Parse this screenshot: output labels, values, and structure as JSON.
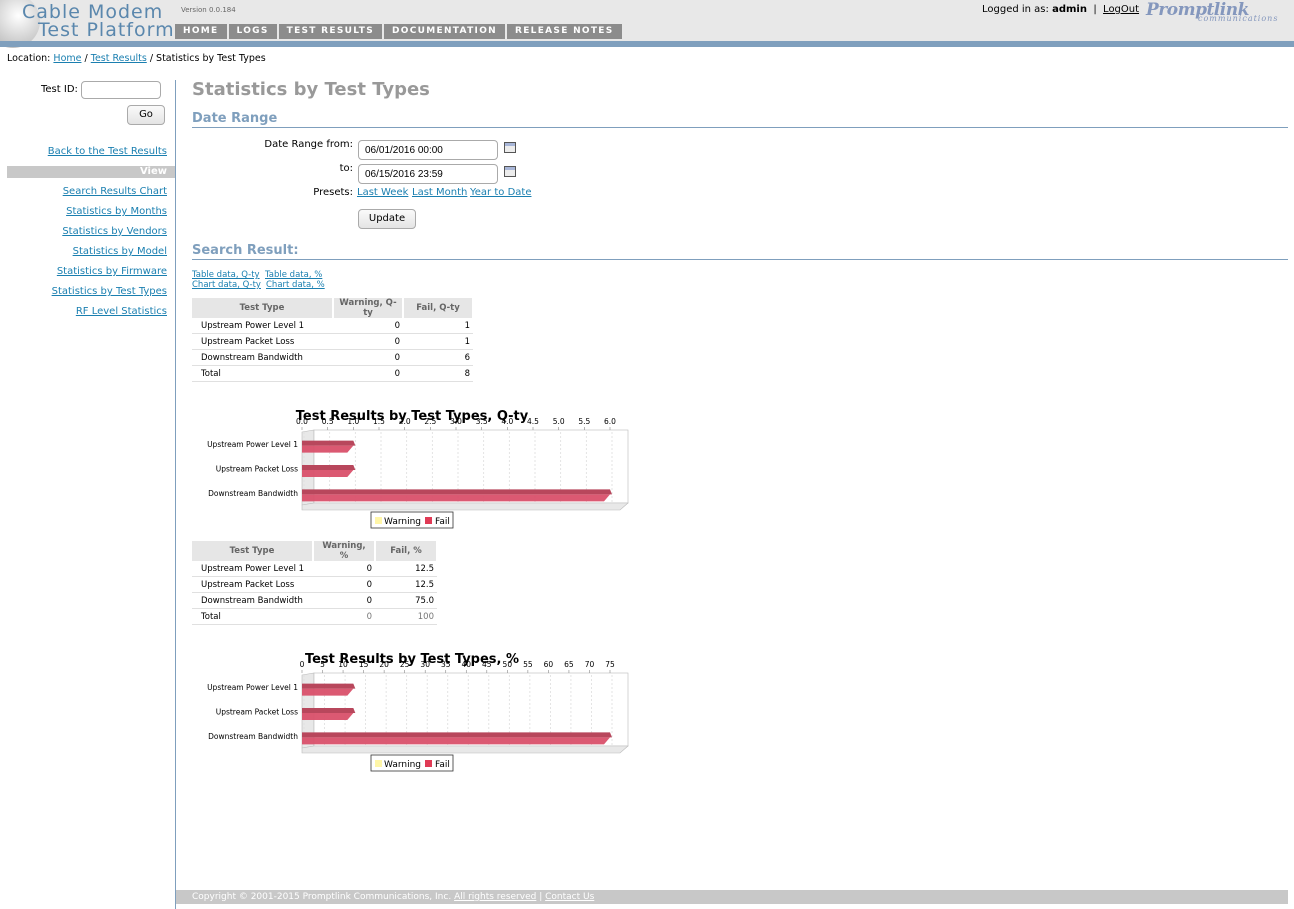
{
  "header": {
    "logo_line1": "Cable Modem",
    "logo_line2": "Test Platform",
    "version": "Version 0.0.184",
    "nav": [
      "HOME",
      "LOGS",
      "TEST RESULTS",
      "DOCUMENTATION",
      "RELEASE NOTES"
    ],
    "logged_in_label": "Logged in as:",
    "username": "admin",
    "separator": "|",
    "logout": "LogOut",
    "brand_name": "Promptlink",
    "brand_sub": "communications"
  },
  "breadcrumb": {
    "prefix": "Location:",
    "home": "Home",
    "sep": "/",
    "test_results": "Test Results",
    "current": "Statistics by Test Types"
  },
  "sidebar": {
    "test_id_label": "Test ID:",
    "test_id_value": "",
    "go": "Go",
    "back": "Back to the Test Results",
    "view_header": "View",
    "links": [
      "Search Results Chart",
      "Statistics by Months",
      "Statistics by Vendors",
      "Statistics by Model",
      "Statistics by Firmware",
      "Statistics by Test Types",
      "RF Level Statistics"
    ]
  },
  "main": {
    "title": "Statistics by Test Types",
    "date_range_title": "Date Range",
    "from_label": "Date Range from:",
    "from_value": "06/01/2016 00:00",
    "to_label": "to:",
    "to_value": "06/15/2016 23:59",
    "presets_label": "Presets:",
    "presets": [
      "Last Week",
      "Last Month",
      "Year to Date"
    ],
    "update": "Update",
    "search_result_title": "Search Result:",
    "quick_links": [
      "Table data, Q-ty",
      "Table data, %",
      "Chart data, Q-ty",
      "Chart data, %"
    ]
  },
  "qty_table": {
    "headers": [
      "Test Type",
      "Warning, Q-ty",
      "Fail, Q-ty"
    ],
    "rows": [
      [
        "Upstream Power Level 1",
        "0",
        "1"
      ],
      [
        "Upstream Packet Loss",
        "0",
        "1"
      ],
      [
        "Downstream Bandwidth",
        "0",
        "6"
      ],
      [
        "Total",
        "0",
        "8"
      ]
    ]
  },
  "pct_table": {
    "headers": [
      "Test Type",
      "Warning, %",
      "Fail, %"
    ],
    "rows": [
      [
        "Upstream Power Level 1",
        "0",
        "12.5"
      ],
      [
        "Upstream Packet Loss",
        "0",
        "12.5"
      ],
      [
        "Downstream Bandwidth",
        "0",
        "75.0"
      ],
      [
        "Total",
        "0",
        "100"
      ]
    ]
  },
  "colors": {
    "fail": "#d9506a",
    "warning": "#fff6a8",
    "accent": "#7f9fbd"
  },
  "chart_data": [
    {
      "type": "bar",
      "title": "Test Results by Test Types, Q-ty",
      "categories": [
        "Upstream Power Level 1",
        "Upstream Packet Loss",
        "Downstream Bandwidth"
      ],
      "series": [
        {
          "name": "Warning",
          "values": [
            0,
            0,
            0
          ]
        },
        {
          "name": "Fail",
          "values": [
            1,
            1,
            6
          ]
        }
      ],
      "xlim": [
        0,
        6.0
      ],
      "ticks": [
        "0.0",
        "0.5",
        "1.0",
        "1.5",
        "2.0",
        "2.5",
        "3.0",
        "3.5",
        "4.0",
        "4.5",
        "5.0",
        "5.5",
        "6.0"
      ],
      "legend": "bottom"
    },
    {
      "type": "bar",
      "title": "Test Results by Test Types, %",
      "categories": [
        "Upstream Power Level 1",
        "Upstream Packet Loss",
        "Downstream Bandwidth"
      ],
      "series": [
        {
          "name": "Warning",
          "values": [
            0,
            0,
            0
          ]
        },
        {
          "name": "Fail",
          "values": [
            12.5,
            12.5,
            75.0
          ]
        }
      ],
      "xlim": [
        0,
        75
      ],
      "ticks": [
        "0",
        "5",
        "10",
        "15",
        "20",
        "25",
        "30",
        "35",
        "40",
        "45",
        "50",
        "55",
        "60",
        "65",
        "70",
        "75"
      ],
      "legend": "bottom"
    }
  ],
  "footer": {
    "copyright": "Copyright © 2001-2015 Promptlink Communications, Inc.",
    "rights": "All rights reserved",
    "sep": "|",
    "contact": "Contact Us"
  }
}
